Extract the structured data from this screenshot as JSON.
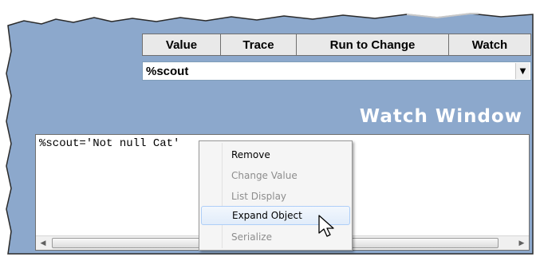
{
  "toolbar": {
    "value_label": "Value",
    "trace_label": "Trace",
    "run_to_change_label": "Run to Change",
    "watch_label": "Watch"
  },
  "combo": {
    "selected": "%scout",
    "arrow_icon": "chevron-down-icon"
  },
  "watch_window": {
    "title": "Watch Window",
    "content": "%scout='Not null Cat'"
  },
  "context_menu": {
    "items": [
      {
        "label": "Remove",
        "enabled": true
      },
      {
        "label": "Change Value",
        "enabled": false
      },
      {
        "label": "List Display",
        "enabled": false
      },
      {
        "label": "Expand Object",
        "enabled": true,
        "highlighted": true
      },
      {
        "label": "Serialize",
        "enabled": false
      }
    ]
  },
  "colors": {
    "panel_blue": "#8ca8cc",
    "title_white": "#ffffff",
    "menu_highlight": "#e1ecfa"
  },
  "scrollbar": {
    "left_icon": "arrow-left-icon",
    "right_icon": "arrow-right-icon"
  }
}
